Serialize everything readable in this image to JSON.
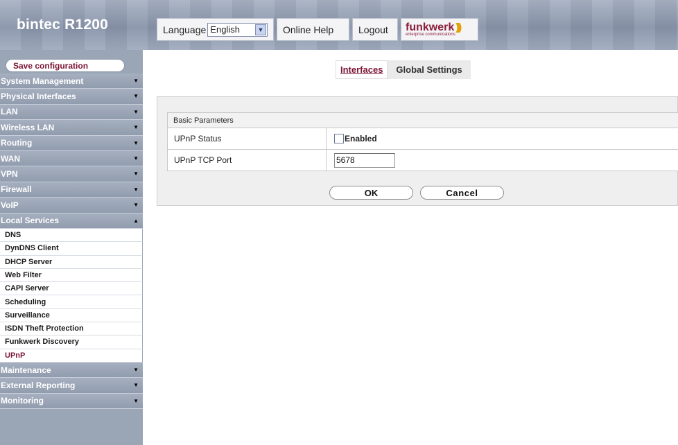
{
  "header": {
    "brand": "bintec R1200",
    "language_label": "Language",
    "language_value": "English",
    "online_help": "Online Help",
    "logout": "Logout",
    "logo": "funkwerk",
    "logo_tagline": "enterprise communications"
  },
  "sidebar": {
    "save_label": "Save configuration",
    "items": [
      {
        "label": "System Management"
      },
      {
        "label": "Physical Interfaces"
      },
      {
        "label": "LAN"
      },
      {
        "label": "Wireless LAN"
      },
      {
        "label": "Routing"
      },
      {
        "label": "WAN"
      },
      {
        "label": "VPN"
      },
      {
        "label": "Firewall"
      },
      {
        "label": "VoIP"
      },
      {
        "label": "Local Services"
      }
    ],
    "submenu": [
      {
        "label": "DNS"
      },
      {
        "label": "DynDNS Client"
      },
      {
        "label": "DHCP Server"
      },
      {
        "label": "Web Filter"
      },
      {
        "label": "CAPI Server"
      },
      {
        "label": "Scheduling"
      },
      {
        "label": "Surveillance"
      },
      {
        "label": "ISDN Theft Protection"
      },
      {
        "label": "Funkwerk Discovery"
      },
      {
        "label": "UPnP"
      }
    ],
    "items_after": [
      {
        "label": "Maintenance"
      },
      {
        "label": "External Reporting"
      },
      {
        "label": "Monitoring"
      }
    ]
  },
  "tabs": {
    "interfaces": "Interfaces",
    "global_settings": "Global Settings"
  },
  "form": {
    "section_title": "Basic Parameters",
    "upnp_status_label": "UPnP Status",
    "upnp_status_checkbox_label": "Enabled",
    "upnp_status_checked": false,
    "tcp_port_label": "UPnP TCP Port",
    "tcp_port_value": "5678"
  },
  "buttons": {
    "ok": "OK",
    "cancel": "Cancel"
  },
  "colors": {
    "accent": "#7a1433",
    "sidebar": "#9aa5b6"
  }
}
